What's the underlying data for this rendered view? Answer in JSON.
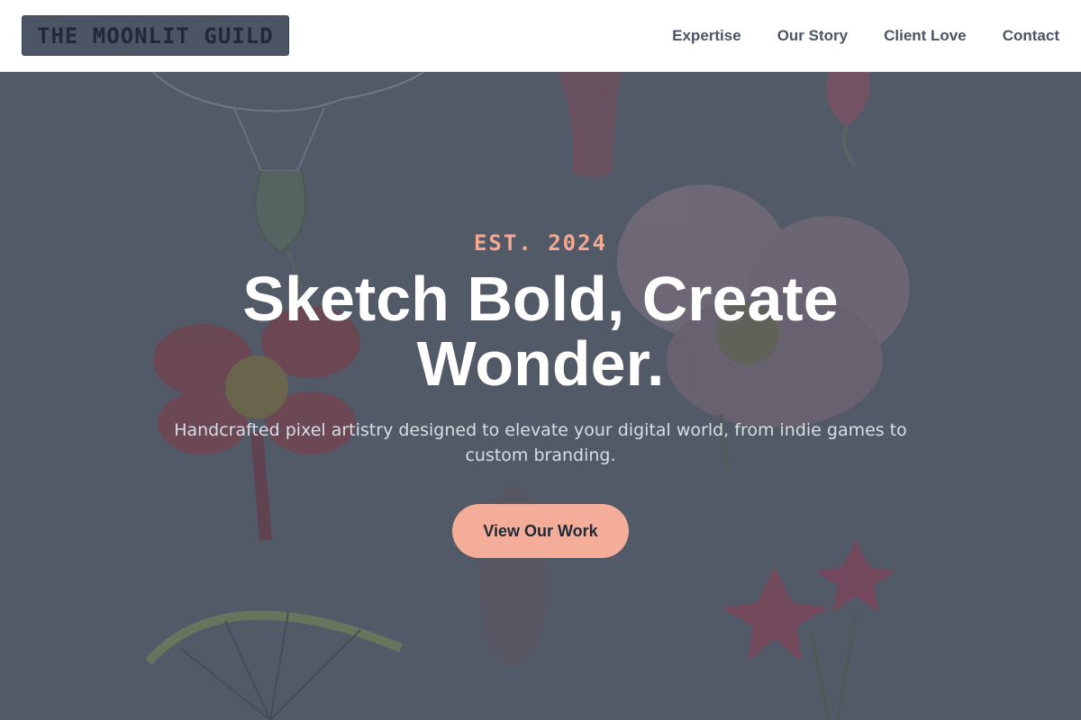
{
  "header": {
    "logo": "THE MOONLIT GUILD",
    "nav": [
      "Expertise",
      "Our Story",
      "Client Love",
      "Contact"
    ]
  },
  "hero": {
    "eyebrow": "EST. 2024",
    "headline": "Sketch Bold, Create Wonder.",
    "subtitle": "Handcrafted pixel artistry designed to elevate your digital world, from indie games to custom branding.",
    "cta": "View Our Work"
  },
  "colors": {
    "header_bg": "#ffffff",
    "logo_bg": "#4b5563",
    "overlay": "#525a68",
    "accent": "#f4a891",
    "cta_bg": "#f4ad99",
    "headline": "#ffffff"
  }
}
